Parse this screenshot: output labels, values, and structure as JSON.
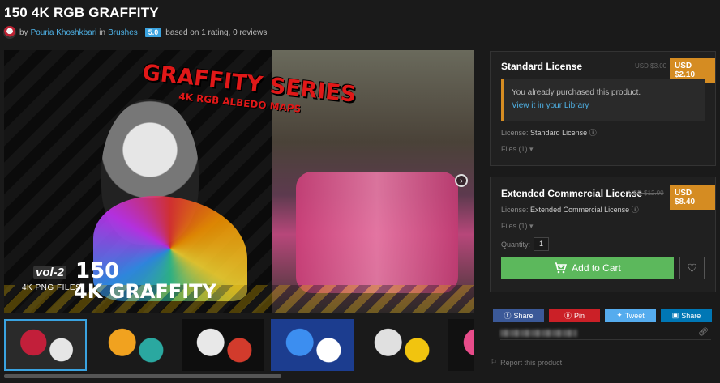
{
  "product": {
    "title": "150 4K RGB GRAFFITY",
    "by_label": "by",
    "author": "Pouria Khoshkbari",
    "in_label": "in",
    "category": "Brushes",
    "rating": "5.0",
    "rating_text": "based on 1 rating, 0 reviews"
  },
  "hero": {
    "series_title": "GRAFFITY SERIES",
    "series_subtitle": "4K RGB ALBEDO MAPS",
    "vol": "vol-2",
    "png_files": "4K PNG FILES",
    "count": "150",
    "graffity": "4K GRAFFITY",
    "next_icon": "›"
  },
  "thumbnails": [
    {
      "name": "thumb-1",
      "colors": [
        "#2a2a2a",
        "#c21f3a",
        "#e6e6e6"
      ]
    },
    {
      "name": "thumb-2",
      "colors": [
        "#1a1a1a",
        "#f1a21f",
        "#2aa8a0"
      ]
    },
    {
      "name": "thumb-3",
      "colors": [
        "#0e0e0e",
        "#e8e8e8",
        "#d23b2c"
      ]
    },
    {
      "name": "thumb-4",
      "colors": [
        "#1c3d8f",
        "#3c8ef0",
        "#ffffff"
      ]
    },
    {
      "name": "thumb-5",
      "colors": [
        "#1a1a1a",
        "#e0e0e0",
        "#f1c40f"
      ]
    },
    {
      "name": "thumb-6",
      "colors": [
        "#111111",
        "#e84c8a",
        "#2ec4e6"
      ]
    },
    {
      "name": "thumb-7",
      "colors": [
        "#0f5b6b",
        "#3fa9c9",
        "#222222"
      ]
    }
  ],
  "standard": {
    "title": "Standard License",
    "old_price": "USD $3.00",
    "price": "USD $2.10",
    "notice": "You already purchased this product.",
    "library_link": "View it in your Library",
    "license_label": "License:",
    "license_value": "Standard License",
    "files": "Files (1)"
  },
  "extended": {
    "title": "Extended Commercial License",
    "old_price": "USD $12.00",
    "price": "USD $8.40",
    "license_label": "License:",
    "license_value": "Extended Commercial License",
    "files": "Files (1)",
    "quantity_label": "Quantity:",
    "quantity": "1",
    "cart_label": "Add to Cart"
  },
  "share": {
    "facebook": "Share",
    "pinterest": "Pin",
    "twitter": "Tweet",
    "linkedin": "Share"
  },
  "report": "Report this product",
  "colors": {
    "accent": "#3aa3e0",
    "price": "#d58c22",
    "cart": "#5cb85c"
  }
}
